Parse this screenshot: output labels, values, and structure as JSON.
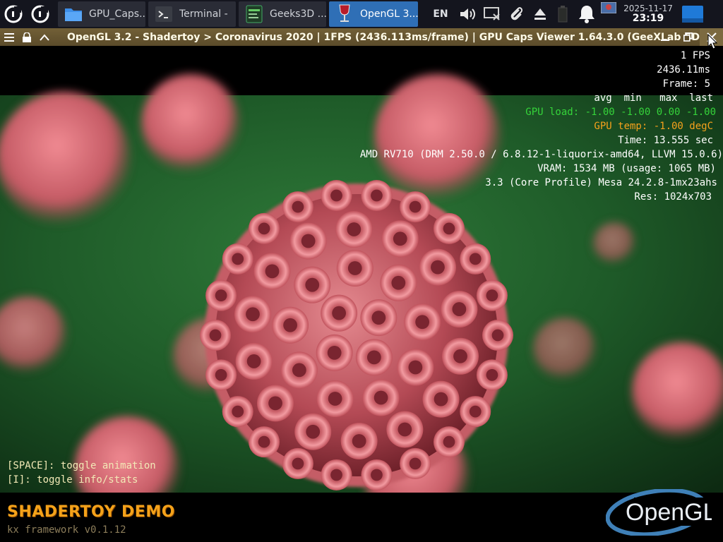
{
  "taskbar": {
    "tasks": [
      {
        "label": "GPU_Caps...",
        "icon": "folder-icon"
      },
      {
        "label": "Terminal -",
        "icon": "terminal-icon"
      },
      {
        "label": "Geeks3D ...",
        "icon": "browser-icon"
      },
      {
        "label": "OpenGL 3...",
        "icon": "wine-glass-icon",
        "active": true
      }
    ],
    "language": "EN",
    "date": "2025-11-17",
    "time": "23:19"
  },
  "window": {
    "title": "OpenGL 3.2 - Shadertoy > Coronavirus 2020 | 1FPS (2436.113ms/frame) | GPU Caps Viewer 1.64.3.0 (GeeXLab SDK)"
  },
  "stats": {
    "fps": "1 FPS",
    "frame_ms": "2436.11ms",
    "frame_count": "Frame: 5",
    "table_header": "avg  min   max  last",
    "gpu_load": "GPU load: -1.00 -1.00 0.00 -1.00",
    "gpu_temp": "GPU temp: -1.00 degC",
    "time": "Time: 13.555 sec",
    "renderer": "AMD RV710 (DRM 2.50.0 / 6.8.12-1-liquorix-amd64, LLVM 15.0.6)",
    "vram": "VRAM: 1534 MB (usage: 1065 MB)",
    "gl_version": "3.3 (Core Profile) Mesa 24.2.8-1mx23ahs",
    "resolution": "Res: 1024x703"
  },
  "help": {
    "space": "[SPACE]: toggle animation",
    "info": "[I]: toggle info/stats"
  },
  "footer": {
    "demo_title": "SHADERTOY DEMO",
    "framework": "kx framework v0.1.12",
    "logo_text": "OpenGL"
  },
  "colors": {
    "gpu_load": "#35d43a",
    "gpu_temp": "#f5a11c",
    "stats_text": "#ffffff",
    "titlebar": "#6b5932",
    "active_task": "#2f6fb6"
  }
}
